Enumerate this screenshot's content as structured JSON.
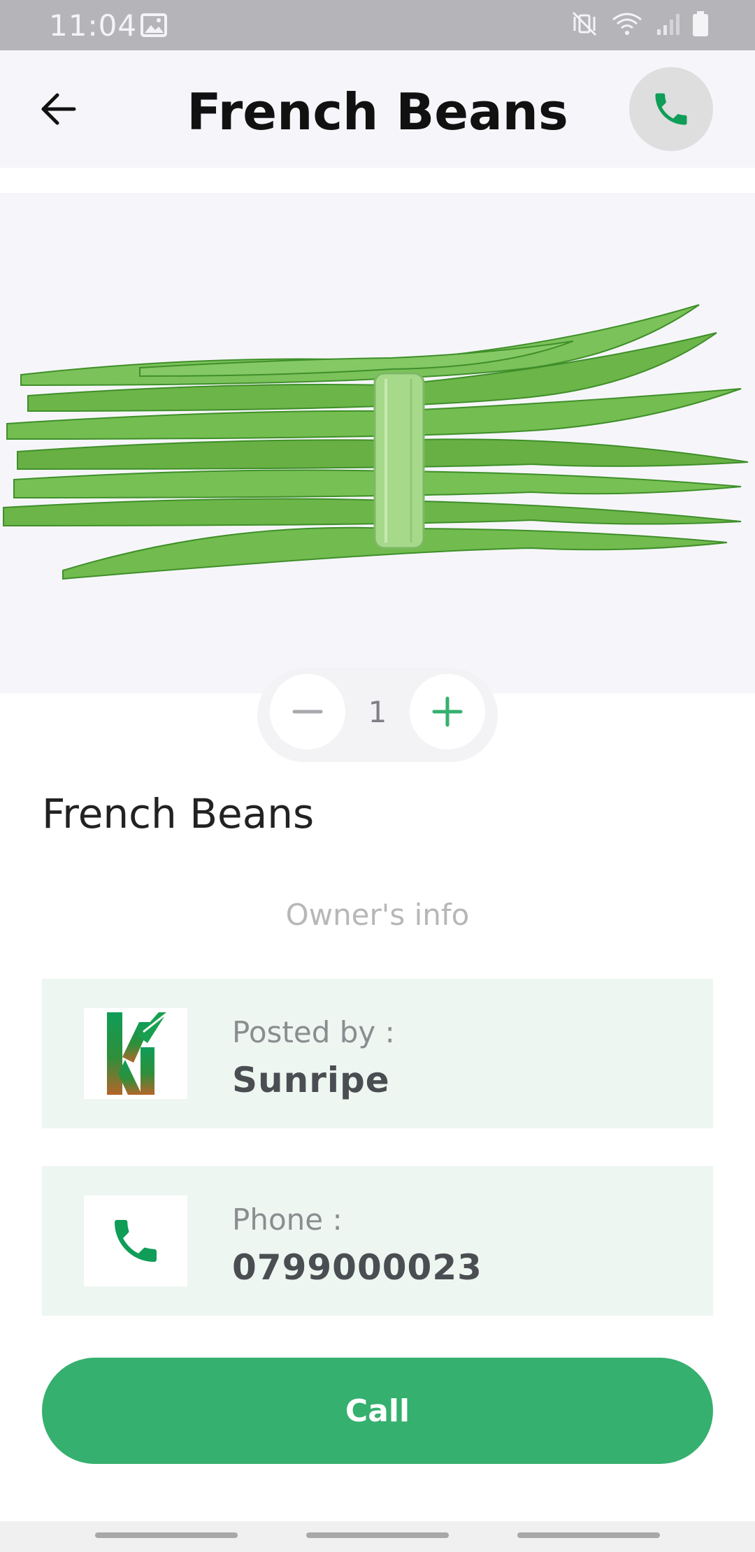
{
  "status_bar": {
    "time": "11:04",
    "icons": [
      "gallery-icon",
      "mute-vibrate-icon",
      "wifi-icon",
      "signal-icon",
      "battery-icon"
    ]
  },
  "app_bar": {
    "title": "French Beans",
    "back_icon": "arrow-left-icon",
    "call_icon": "phone-icon"
  },
  "product": {
    "image": "french-beans-bundle",
    "name": "French Beans"
  },
  "quantity": {
    "value": "1",
    "minus_icon": "minus-icon",
    "plus_icon": "plus-icon"
  },
  "owner": {
    "heading": "Owner's info",
    "posted_by_label": "Posted by :",
    "posted_by_value": "Sunripe",
    "phone_label": "Phone :",
    "phone_value": "0799000023"
  },
  "actions": {
    "call_label": "Call"
  },
  "colors": {
    "accent": "#35b06e",
    "phone_icon": "#0f9d58",
    "card_bg": "#eef6f1",
    "image_bg": "#f6f6fa"
  }
}
